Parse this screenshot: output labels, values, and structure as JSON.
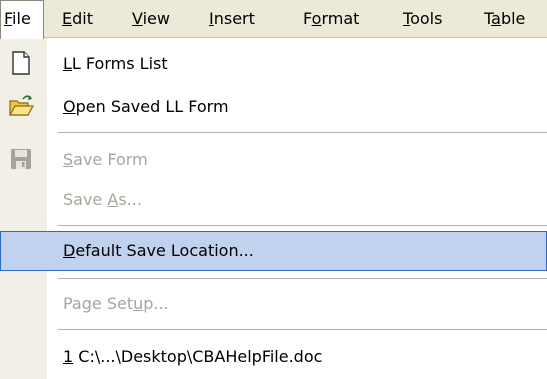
{
  "menubar": {
    "items": [
      {
        "pre": "",
        "key": "F",
        "post": "ile"
      },
      {
        "pre": "",
        "key": "E",
        "post": "dit"
      },
      {
        "pre": "",
        "key": "V",
        "post": "iew"
      },
      {
        "pre": "",
        "key": "I",
        "post": "nsert"
      },
      {
        "pre": "F",
        "key": "o",
        "post": "rmat"
      },
      {
        "pre": "",
        "key": "T",
        "post": "ools"
      },
      {
        "pre": "T",
        "key": "a",
        "post": "ble"
      }
    ]
  },
  "file_menu": {
    "items": [
      {
        "pre": "",
        "key": "L",
        "post": "L Forms List",
        "icon": "new-document-icon",
        "enabled": true
      },
      {
        "pre": "",
        "key": "O",
        "post": "pen Saved LL Form",
        "icon": "open-folder-icon",
        "enabled": true
      },
      {
        "pre": "",
        "key": "S",
        "post": "ave Form",
        "icon": "save-disk-icon",
        "enabled": false
      },
      {
        "pre": "Save ",
        "key": "A",
        "post": "s...",
        "icon": "",
        "enabled": false
      },
      {
        "pre": "",
        "key": "D",
        "post": "efault Save Location...",
        "icon": "",
        "enabled": true,
        "highlighted": true
      },
      {
        "pre": "Page Set",
        "key": "u",
        "post": "p...",
        "icon": "",
        "enabled": false
      },
      {
        "pre": "",
        "key": "1",
        "post": " C:\\...\\Desktop\\CBAHelpFile.doc",
        "icon": "",
        "enabled": true
      }
    ]
  },
  "colors": {
    "menubar_bg": "#ece9d8",
    "icon_column_bg": "#f1efe6",
    "highlight_bg": "#c1d2ee",
    "highlight_border": "#316ac5",
    "disabled_text": "#a7a59c"
  }
}
